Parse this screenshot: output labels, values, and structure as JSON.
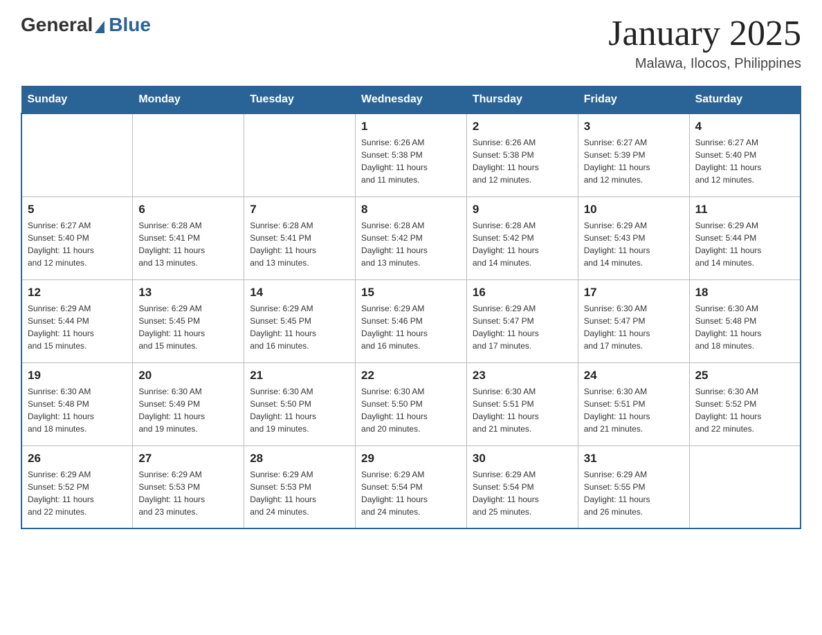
{
  "header": {
    "logo_general": "General",
    "logo_blue": "Blue",
    "month_title": "January 2025",
    "location": "Malawa, Ilocos, Philippines"
  },
  "weekdays": [
    "Sunday",
    "Monday",
    "Tuesday",
    "Wednesday",
    "Thursday",
    "Friday",
    "Saturday"
  ],
  "weeks": [
    [
      {
        "day": "",
        "info": ""
      },
      {
        "day": "",
        "info": ""
      },
      {
        "day": "",
        "info": ""
      },
      {
        "day": "1",
        "info": "Sunrise: 6:26 AM\nSunset: 5:38 PM\nDaylight: 11 hours\nand 11 minutes."
      },
      {
        "day": "2",
        "info": "Sunrise: 6:26 AM\nSunset: 5:38 PM\nDaylight: 11 hours\nand 12 minutes."
      },
      {
        "day": "3",
        "info": "Sunrise: 6:27 AM\nSunset: 5:39 PM\nDaylight: 11 hours\nand 12 minutes."
      },
      {
        "day": "4",
        "info": "Sunrise: 6:27 AM\nSunset: 5:40 PM\nDaylight: 11 hours\nand 12 minutes."
      }
    ],
    [
      {
        "day": "5",
        "info": "Sunrise: 6:27 AM\nSunset: 5:40 PM\nDaylight: 11 hours\nand 12 minutes."
      },
      {
        "day": "6",
        "info": "Sunrise: 6:28 AM\nSunset: 5:41 PM\nDaylight: 11 hours\nand 13 minutes."
      },
      {
        "day": "7",
        "info": "Sunrise: 6:28 AM\nSunset: 5:41 PM\nDaylight: 11 hours\nand 13 minutes."
      },
      {
        "day": "8",
        "info": "Sunrise: 6:28 AM\nSunset: 5:42 PM\nDaylight: 11 hours\nand 13 minutes."
      },
      {
        "day": "9",
        "info": "Sunrise: 6:28 AM\nSunset: 5:42 PM\nDaylight: 11 hours\nand 14 minutes."
      },
      {
        "day": "10",
        "info": "Sunrise: 6:29 AM\nSunset: 5:43 PM\nDaylight: 11 hours\nand 14 minutes."
      },
      {
        "day": "11",
        "info": "Sunrise: 6:29 AM\nSunset: 5:44 PM\nDaylight: 11 hours\nand 14 minutes."
      }
    ],
    [
      {
        "day": "12",
        "info": "Sunrise: 6:29 AM\nSunset: 5:44 PM\nDaylight: 11 hours\nand 15 minutes."
      },
      {
        "day": "13",
        "info": "Sunrise: 6:29 AM\nSunset: 5:45 PM\nDaylight: 11 hours\nand 15 minutes."
      },
      {
        "day": "14",
        "info": "Sunrise: 6:29 AM\nSunset: 5:45 PM\nDaylight: 11 hours\nand 16 minutes."
      },
      {
        "day": "15",
        "info": "Sunrise: 6:29 AM\nSunset: 5:46 PM\nDaylight: 11 hours\nand 16 minutes."
      },
      {
        "day": "16",
        "info": "Sunrise: 6:29 AM\nSunset: 5:47 PM\nDaylight: 11 hours\nand 17 minutes."
      },
      {
        "day": "17",
        "info": "Sunrise: 6:30 AM\nSunset: 5:47 PM\nDaylight: 11 hours\nand 17 minutes."
      },
      {
        "day": "18",
        "info": "Sunrise: 6:30 AM\nSunset: 5:48 PM\nDaylight: 11 hours\nand 18 minutes."
      }
    ],
    [
      {
        "day": "19",
        "info": "Sunrise: 6:30 AM\nSunset: 5:48 PM\nDaylight: 11 hours\nand 18 minutes."
      },
      {
        "day": "20",
        "info": "Sunrise: 6:30 AM\nSunset: 5:49 PM\nDaylight: 11 hours\nand 19 minutes."
      },
      {
        "day": "21",
        "info": "Sunrise: 6:30 AM\nSunset: 5:50 PM\nDaylight: 11 hours\nand 19 minutes."
      },
      {
        "day": "22",
        "info": "Sunrise: 6:30 AM\nSunset: 5:50 PM\nDaylight: 11 hours\nand 20 minutes."
      },
      {
        "day": "23",
        "info": "Sunrise: 6:30 AM\nSunset: 5:51 PM\nDaylight: 11 hours\nand 21 minutes."
      },
      {
        "day": "24",
        "info": "Sunrise: 6:30 AM\nSunset: 5:51 PM\nDaylight: 11 hours\nand 21 minutes."
      },
      {
        "day": "25",
        "info": "Sunrise: 6:30 AM\nSunset: 5:52 PM\nDaylight: 11 hours\nand 22 minutes."
      }
    ],
    [
      {
        "day": "26",
        "info": "Sunrise: 6:29 AM\nSunset: 5:52 PM\nDaylight: 11 hours\nand 22 minutes."
      },
      {
        "day": "27",
        "info": "Sunrise: 6:29 AM\nSunset: 5:53 PM\nDaylight: 11 hours\nand 23 minutes."
      },
      {
        "day": "28",
        "info": "Sunrise: 6:29 AM\nSunset: 5:53 PM\nDaylight: 11 hours\nand 24 minutes."
      },
      {
        "day": "29",
        "info": "Sunrise: 6:29 AM\nSunset: 5:54 PM\nDaylight: 11 hours\nand 24 minutes."
      },
      {
        "day": "30",
        "info": "Sunrise: 6:29 AM\nSunset: 5:54 PM\nDaylight: 11 hours\nand 25 minutes."
      },
      {
        "day": "31",
        "info": "Sunrise: 6:29 AM\nSunset: 5:55 PM\nDaylight: 11 hours\nand 26 minutes."
      },
      {
        "day": "",
        "info": ""
      }
    ]
  ]
}
